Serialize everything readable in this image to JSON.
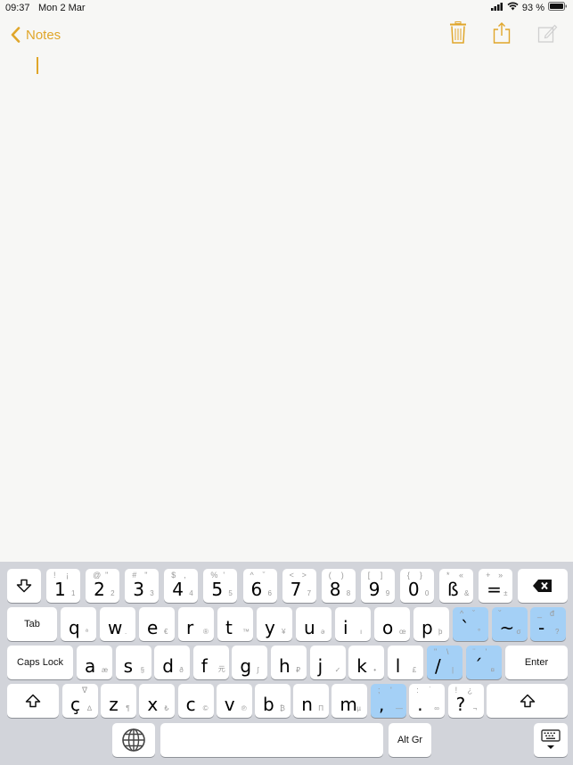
{
  "status_bar": {
    "time": "09:37",
    "date": "Mon 2 Mar",
    "battery_pct": "93 %",
    "icons": [
      "cellular-signal-icon",
      "wifi-icon",
      "battery-icon"
    ]
  },
  "nav": {
    "back_label": "Notes",
    "icons": [
      "trash-icon",
      "share-icon",
      "compose-icon"
    ],
    "accent_color": "#e0a62a"
  },
  "note": {
    "body": ""
  },
  "keyboard": {
    "row1": [
      {
        "main": "1",
        "tl": "!",
        "tr": "¡",
        "sub": "1"
      },
      {
        "main": "2",
        "tl": "@",
        "tr": "\"",
        "sub": "2"
      },
      {
        "main": "3",
        "tl": "#",
        "tr": "\"",
        "sub": "3"
      },
      {
        "main": "4",
        "tl": "$",
        "tr": ",",
        "sub": "4"
      },
      {
        "main": "5",
        "tl": "%",
        "tr": "'",
        "sub": "5"
      },
      {
        "main": "6",
        "tl": "^",
        "tr": "ˇ",
        "sub": "6"
      },
      {
        "main": "7",
        "tl": "<",
        "tr": ">",
        "sub": "7"
      },
      {
        "main": "8",
        "tl": "(",
        "tr": ")",
        "sub": "8"
      },
      {
        "main": "9",
        "tl": "[",
        "tr": "]",
        "sub": "9"
      },
      {
        "main": "0",
        "tl": "{",
        "tr": "}",
        "sub": "0"
      },
      {
        "main": "ß",
        "tl": "*",
        "tr": "«",
        "sub": "&"
      },
      {
        "main": "=",
        "tl": "+",
        "tr": "»",
        "sub": "±"
      }
    ],
    "row2": [
      {
        "main": "q",
        "sub": "ª"
      },
      {
        "main": "w",
        "sub": "."
      },
      {
        "main": "e",
        "sub": "€"
      },
      {
        "main": "r",
        "sub": "®"
      },
      {
        "main": "t",
        "sub": "™"
      },
      {
        "main": "y",
        "sub": "¥"
      },
      {
        "main": "u",
        "sub": "ə"
      },
      {
        "main": "i",
        "sub": "ı"
      },
      {
        "main": "o",
        "sub": "œ"
      },
      {
        "main": "p",
        "sub": "þ"
      }
    ],
    "row2_blue": [
      {
        "main": "`",
        "tl": "^",
        "tr": "ˇ",
        "sub": "°"
      },
      {
        "main": "~",
        "tl": "˘",
        "tr": "",
        "sub": "σ"
      },
      {
        "main": "-",
        "tl": "_",
        "tr": "đ",
        "sub": "?"
      }
    ],
    "row3": [
      {
        "main": "a",
        "sub": "æ"
      },
      {
        "main": "s",
        "sub": "§"
      },
      {
        "main": "d",
        "sub": "ð"
      },
      {
        "main": "f",
        "sub": "元"
      },
      {
        "main": "g",
        "sub": "ʃ"
      },
      {
        "main": "h",
        "sub": "₽"
      },
      {
        "main": "j",
        "sub": "✓"
      },
      {
        "main": "k",
        "sub": "•"
      },
      {
        "main": "l",
        "sub": "£"
      }
    ],
    "row3_blue": [
      {
        "main": "/",
        "tl": "\"",
        "tr": "\\",
        "sub": "|"
      },
      {
        "main": "´",
        "tl": "¨",
        "tr": "'",
        "sub": "¤"
      }
    ],
    "row4": [
      {
        "main": "ç",
        "tl": "",
        "tr": "∇",
        "sub": "∆"
      },
      {
        "main": "z",
        "sub": "¶"
      },
      {
        "main": "x",
        "sub": "₺"
      },
      {
        "main": "c",
        "sub": "©"
      },
      {
        "main": "v",
        "sub": "℗"
      },
      {
        "main": "b",
        "sub": "₿"
      },
      {
        "main": "n",
        "sub": "Π"
      },
      {
        "main": "m",
        "sub": "µ"
      }
    ],
    "row4_punct": [
      {
        "main": ",",
        "tl": ";",
        "tr": "'",
        "sub": "—",
        "blue": true
      },
      {
        "main": ".",
        "tl": ":",
        "tr": "˙",
        "sub": "∞",
        "blue": false
      },
      {
        "main": "?",
        "tl": "!",
        "tr": "¿",
        "sub": "¬",
        "blue": false
      }
    ],
    "labels": {
      "tab": "Tab",
      "caps_lock": "Caps Lock",
      "enter": "Enter",
      "alt_gr": "Alt Gr"
    },
    "icons": [
      "shift-down-icon",
      "backspace-icon",
      "shift-icon",
      "globe-icon",
      "keyboard-dismiss-icon"
    ],
    "highlight_color": "#a4d0f6"
  }
}
